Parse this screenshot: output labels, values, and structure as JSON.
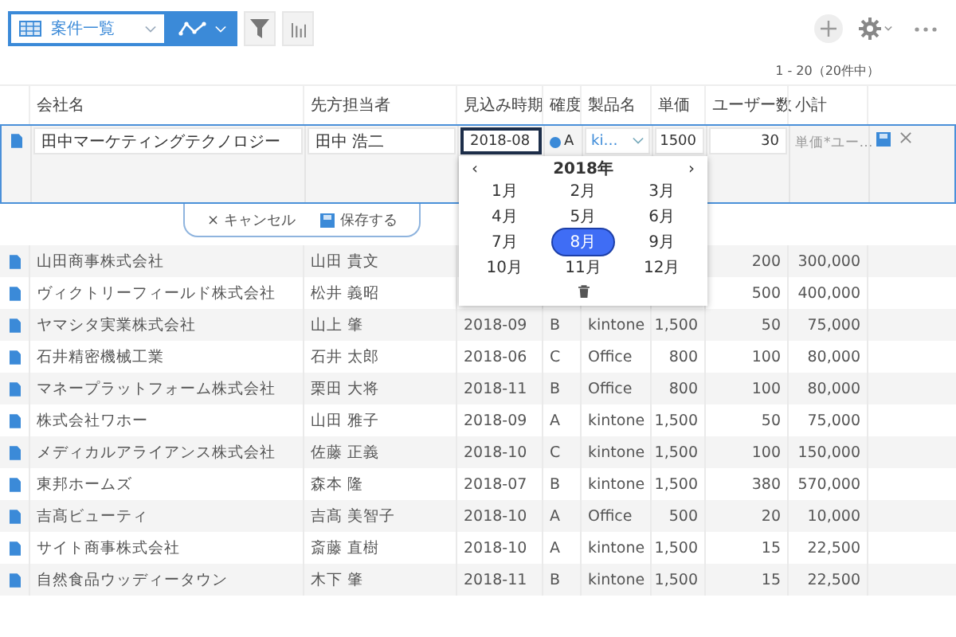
{
  "view_selector": {
    "label": "案件一覧"
  },
  "pager": "1 - 20（20件中）",
  "columns": [
    "会社名",
    "先方担当者",
    "見込み時期",
    "確度",
    "製品名",
    "単価",
    "ユーザー数",
    "小計"
  ],
  "edit_row": {
    "company": "田中マーケティングテクノロジー",
    "contact": "田中 浩二",
    "date": "2018-08",
    "probability": "A",
    "probability_selected": true,
    "product": "ki…",
    "price": "1500",
    "users": "30",
    "subtotal": "単価*ユー…"
  },
  "actions": {
    "cancel_icon": "×",
    "cancel": "キャンセル",
    "save": "保存する"
  },
  "month_picker": {
    "prev": "‹",
    "year": "2018年",
    "next": "›",
    "months": [
      {
        "label": "1月",
        "selected": false
      },
      {
        "label": "2月",
        "selected": false
      },
      {
        "label": "3月",
        "selected": false
      },
      {
        "label": "4月",
        "selected": false
      },
      {
        "label": "5月",
        "selected": false
      },
      {
        "label": "6月",
        "selected": false
      },
      {
        "label": "7月",
        "selected": false
      },
      {
        "label": "8月",
        "selected": true
      },
      {
        "label": "9月",
        "selected": false
      },
      {
        "label": "10月",
        "selected": false
      },
      {
        "label": "11月",
        "selected": false
      },
      {
        "label": "12月",
        "selected": false
      }
    ]
  },
  "rows": [
    {
      "company": "山田商事株式会社",
      "contact": "山田 貴文",
      "users": "200",
      "subtotal": "300,000"
    },
    {
      "company": "ヴィクトリーフィールド株式会社",
      "contact": "松井 義昭",
      "users": "500",
      "subtotal": "400,000"
    },
    {
      "company": "ヤマシタ実業株式会社",
      "contact": "山上 肇",
      "date": "2018-09",
      "probability": "B",
      "product": "kintone",
      "price": "1,500",
      "users": "50",
      "subtotal": "75,000"
    },
    {
      "company": "石井精密機械工業",
      "contact": "石井 太郎",
      "date": "2018-06",
      "probability": "C",
      "product": "Office",
      "price": "800",
      "users": "100",
      "subtotal": "80,000"
    },
    {
      "company": "マネープラットフォーム株式会社",
      "contact": "栗田 大将",
      "date": "2018-11",
      "probability": "B",
      "product": "Office",
      "price": "800",
      "users": "100",
      "subtotal": "80,000"
    },
    {
      "company": "株式会社ワホー",
      "contact": "山田 雅子",
      "date": "2018-09",
      "probability": "A",
      "product": "kintone",
      "price": "1,500",
      "users": "50",
      "subtotal": "75,000"
    },
    {
      "company": "メディカルアライアンス株式会社",
      "contact": "佐藤 正義",
      "date": "2018-10",
      "probability": "C",
      "product": "kintone",
      "price": "1,500",
      "users": "100",
      "subtotal": "150,000"
    },
    {
      "company": "東邦ホームズ",
      "contact": "森本 隆",
      "date": "2018-07",
      "probability": "B",
      "product": "kintone",
      "price": "1,500",
      "users": "380",
      "subtotal": "570,000"
    },
    {
      "company": "吉髙ビューティ",
      "contact": "吉髙 美智子",
      "date": "2018-10",
      "probability": "A",
      "product": "Office",
      "price": "500",
      "users": "20",
      "subtotal": "10,000"
    },
    {
      "company": "サイト商事株式会社",
      "contact": "斎藤 直樹",
      "date": "2018-10",
      "probability": "A",
      "product": "kintone",
      "price": "1,500",
      "users": "15",
      "subtotal": "22,500"
    },
    {
      "company": "自然食品ウッディータウン",
      "contact": "木下 肇",
      "date": "2018-11",
      "probability": "B",
      "product": "kintone",
      "price": "1,500",
      "users": "15",
      "subtotal": "22,500"
    }
  ]
}
